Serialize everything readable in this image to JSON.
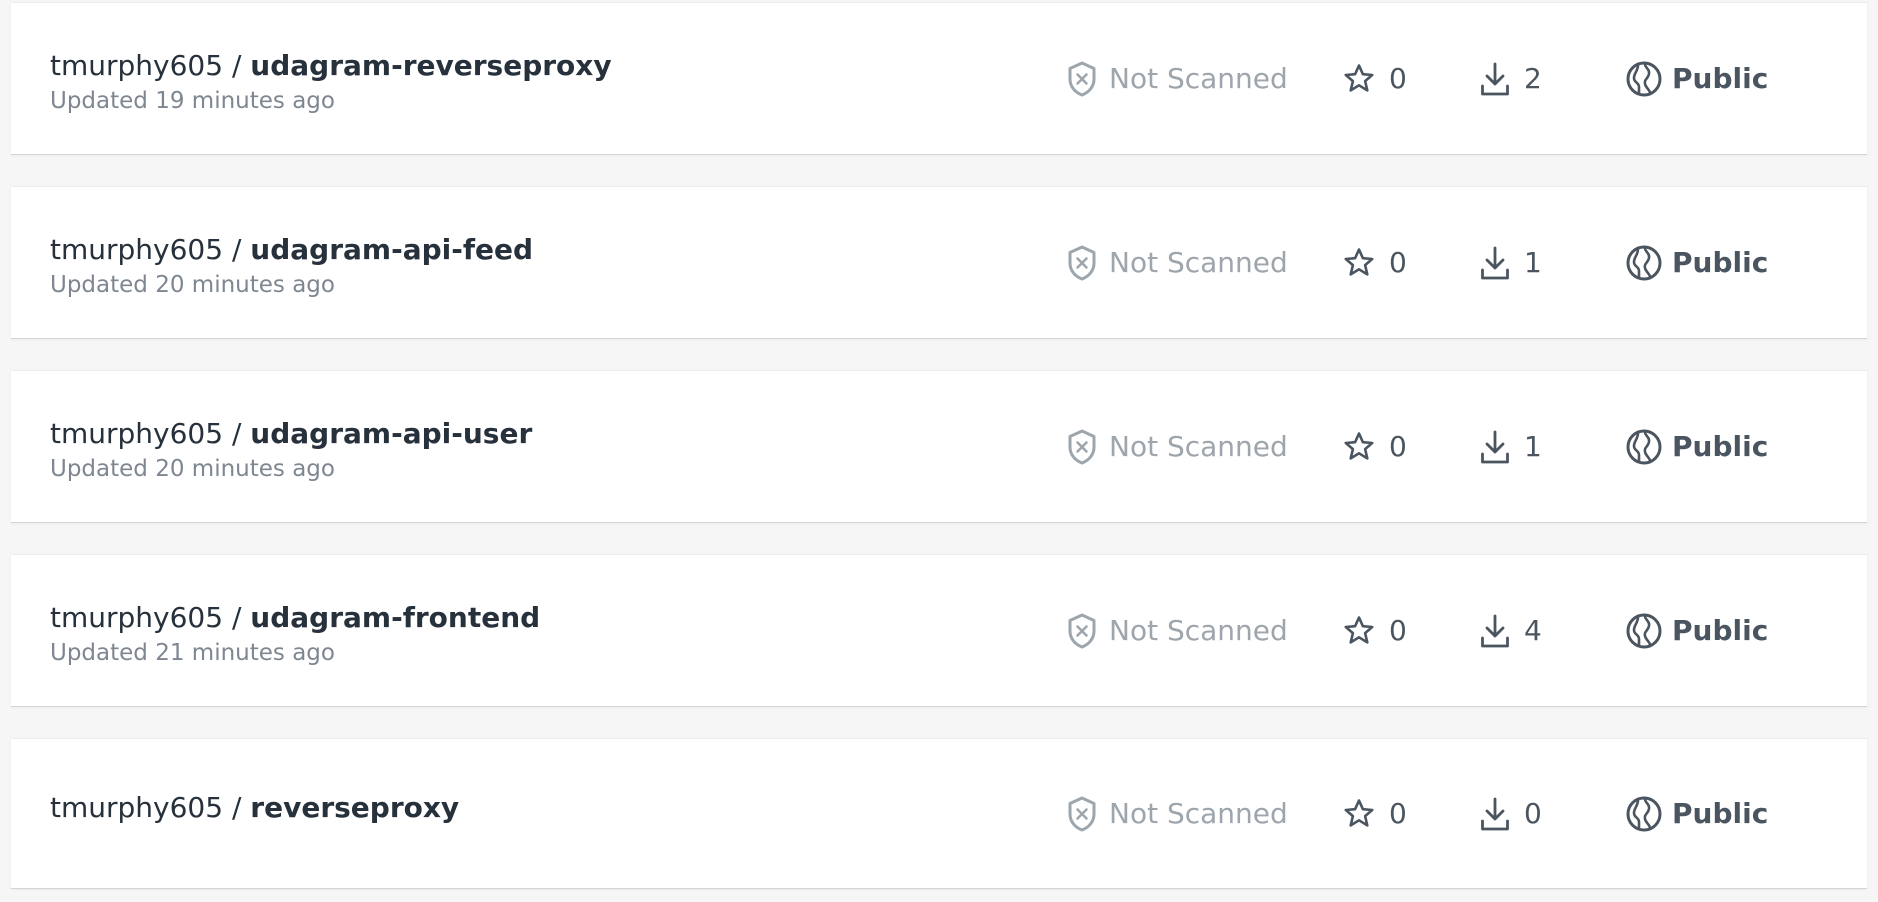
{
  "repositories": [
    {
      "owner": "tmurphy605",
      "separator": " / ",
      "name": "udagram-reverseproxy",
      "updated": "Updated 19 minutes ago",
      "scan_status": "Not Scanned",
      "stars": "0",
      "pulls": "2",
      "visibility": "Public"
    },
    {
      "owner": "tmurphy605",
      "separator": " / ",
      "name": "udagram-api-feed",
      "updated": "Updated 20 minutes ago",
      "scan_status": "Not Scanned",
      "stars": "0",
      "pulls": "1",
      "visibility": "Public"
    },
    {
      "owner": "tmurphy605",
      "separator": " / ",
      "name": "udagram-api-user",
      "updated": "Updated 20 minutes ago",
      "scan_status": "Not Scanned",
      "stars": "0",
      "pulls": "1",
      "visibility": "Public"
    },
    {
      "owner": "tmurphy605",
      "separator": " / ",
      "name": "udagram-frontend",
      "updated": "Updated 21 minutes ago",
      "scan_status": "Not Scanned",
      "stars": "0",
      "pulls": "4",
      "visibility": "Public"
    },
    {
      "owner": "tmurphy605",
      "separator": " / ",
      "name": "reverseproxy",
      "scan_status": "Not Scanned",
      "stars": "0",
      "pulls": "0",
      "visibility": "Public"
    }
  ],
  "icons": {
    "scan": "shield-x-icon",
    "stars": "star-icon",
    "pulls": "download-icon",
    "visibility": "globe-icon"
  },
  "colors": {
    "page_background": "#f6f6f6",
    "card_background": "#ffffff",
    "primary_text": "#27313b",
    "secondary_text": "#7e8791",
    "muted_text": "#9da5ad",
    "icon": "#4b5560"
  }
}
